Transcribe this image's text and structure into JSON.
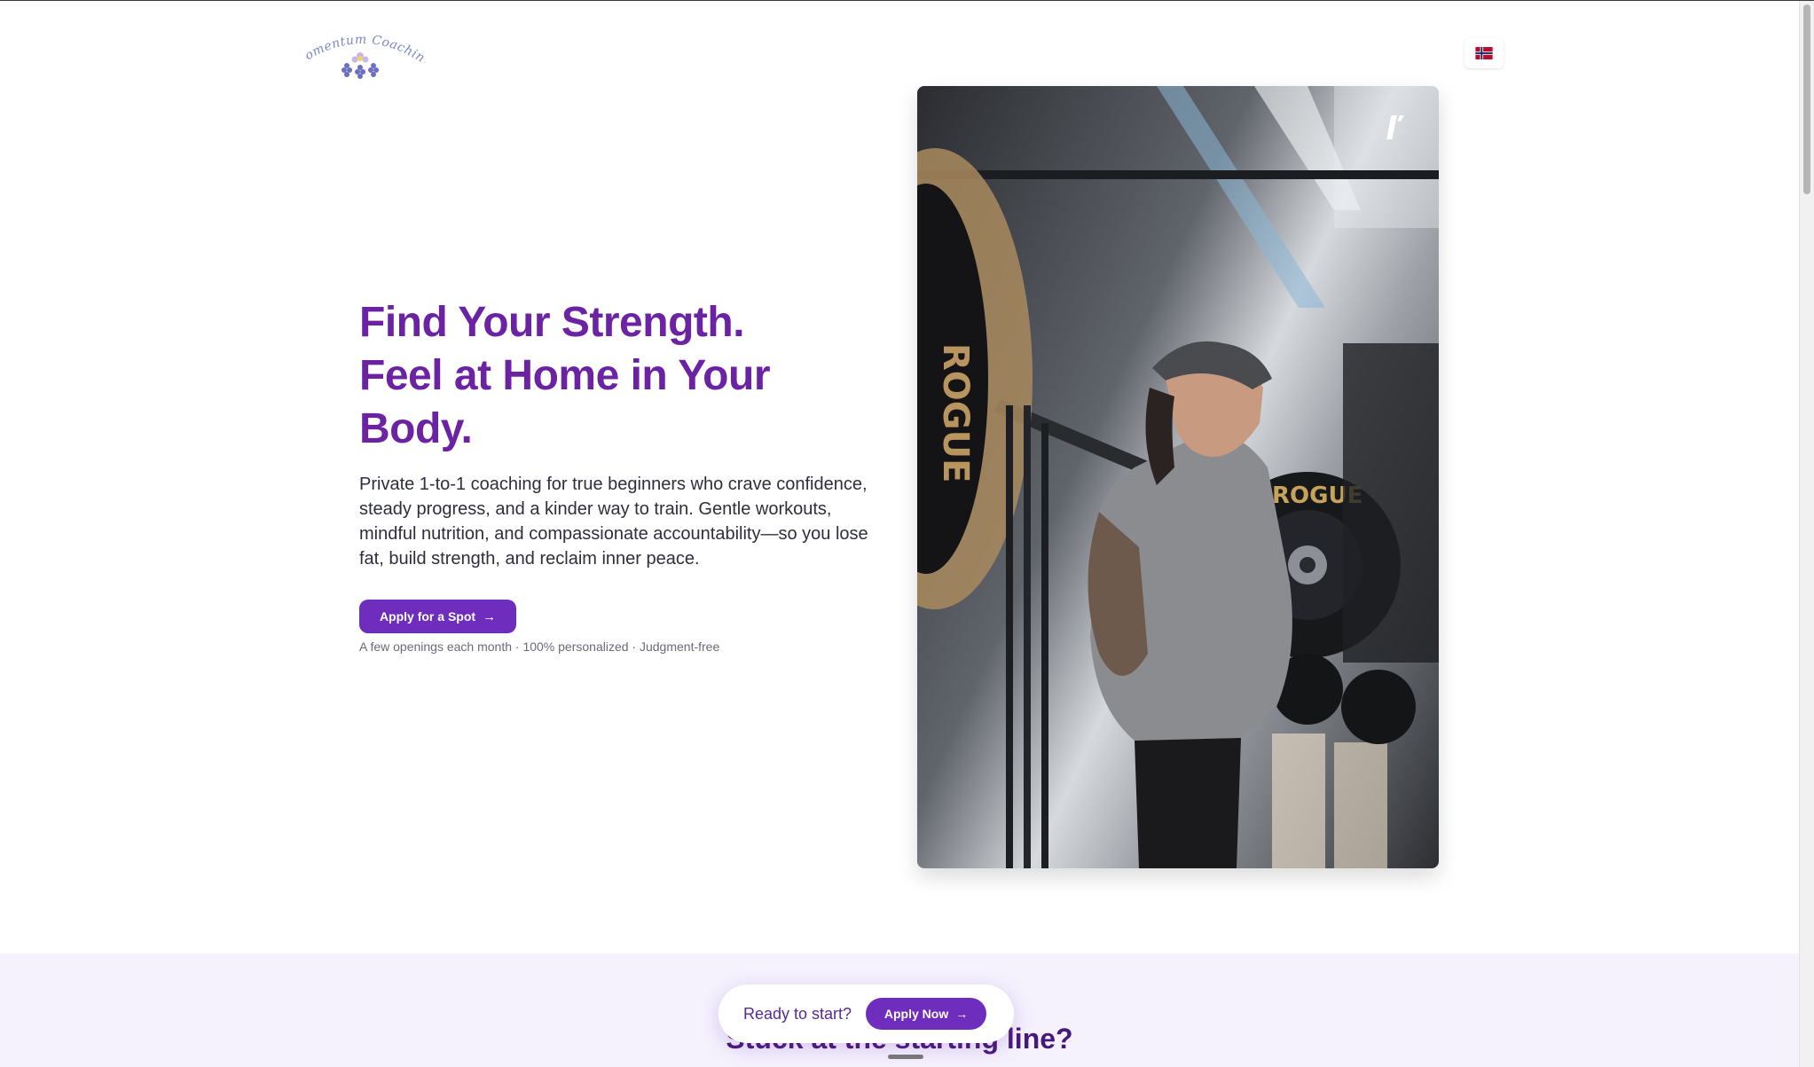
{
  "header": {
    "logo_text": "Momentum Coaching",
    "language_flag_icon": "norway-flag-icon"
  },
  "hero": {
    "title_lines": [
      "Find Your Strength.",
      "Feel at Home in Your",
      "Body."
    ],
    "description": "Private 1-to-1 coaching for true beginners who crave confidence, steady progress, and a kinder way to train. Gentle workouts, mindful nutrition, and compassionate accountability—so you lose fat, build strength, and reclaim inner peace.",
    "cta_label": "Apply for a Spot",
    "note": "A few openings each month · 100% personalized · Judgment-free"
  },
  "photo": {
    "plate_brand": "ROGUE"
  },
  "next_section": {
    "heading": "Stuck at the starting line?"
  },
  "floating_cta": {
    "text": "Ready to start?",
    "button_label": "Apply Now"
  },
  "colors": {
    "brand_purple": "#6f2dbd",
    "heading_purple": "#6b23a3",
    "section_background": "#f5f2fd"
  }
}
